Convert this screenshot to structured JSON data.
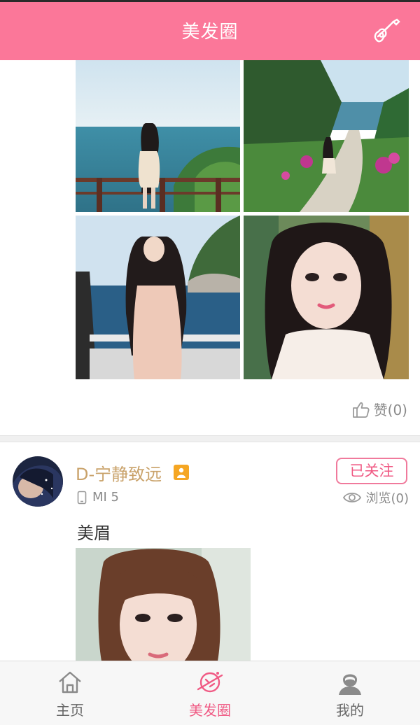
{
  "header": {
    "title": "美发圈"
  },
  "post1": {
    "like_label": "赞(0)"
  },
  "post2": {
    "username": "D-宁静致远",
    "device": "MI 5",
    "follow_label": "已关注",
    "views_label": "浏览(0)",
    "text": "美眉"
  },
  "tabs": [
    {
      "label": "主页",
      "icon": "home-icon"
    },
    {
      "label": "美发圈",
      "icon": "planet-icon"
    },
    {
      "label": "我的",
      "icon": "user-icon"
    }
  ],
  "colors": {
    "brand": "#fb7799",
    "accent": "#f05a84",
    "username": "#c9a26a"
  }
}
